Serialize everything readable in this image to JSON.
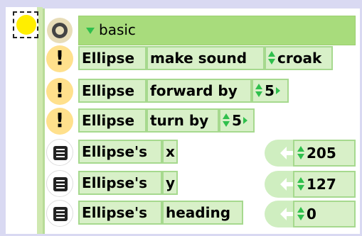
{
  "category": {
    "label": "basic"
  },
  "commands": [
    {
      "object": "Ellipse",
      "action": "make sound",
      "value": "croak"
    },
    {
      "object": "Ellipse",
      "action": "forward by",
      "value": "5"
    },
    {
      "object": "Ellipse",
      "action": "turn by",
      "value": "5"
    }
  ],
  "readouts": [
    {
      "object": "Ellipse's",
      "property": "x",
      "value": "205"
    },
    {
      "object": "Ellipse's",
      "property": "y",
      "value": "127"
    },
    {
      "object": "Ellipse's",
      "property": "heading",
      "value": "0"
    }
  ],
  "colors": {
    "category_bar": "#a8dc7c",
    "arrow_green": "#2fbf4c",
    "tile_yellow": "#ffee00",
    "command_handle": "#ffe08c"
  },
  "icons": {
    "category_handle": "ring-icon",
    "command_handle": "exclamation-icon",
    "readout_handle": "list-icon",
    "readout_arrow": "left-arrow-icon",
    "stepper": "up-down-arrows-icon",
    "expander": "triangle-down-icon"
  }
}
